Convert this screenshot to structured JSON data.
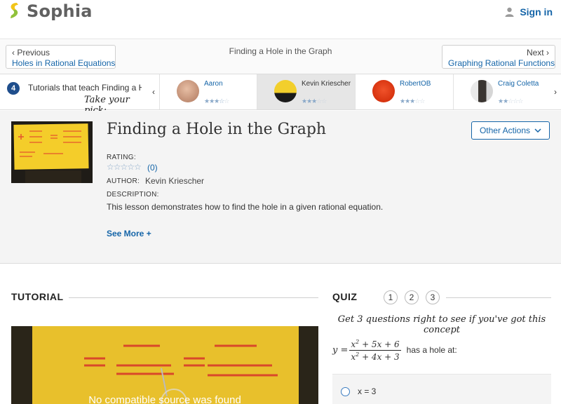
{
  "header": {
    "logo_text": "Sophia",
    "signin_label": "Sign in"
  },
  "nav": {
    "prev_dir": "Previous",
    "prev_title": "Holes in Rational Equations",
    "current_title": "Finding a Hole in the Graph",
    "next_dir": "Next",
    "next_title": "Graphing Rational Functions"
  },
  "tutors": {
    "count": "4",
    "label": "Tutorials that teach Finding a Hole in the Graph",
    "take_pick": "Take your pick:",
    "items": [
      {
        "name": "Aaron",
        "rating": 3.5
      },
      {
        "name": "Kevin Kriescher",
        "rating": 3
      },
      {
        "name": "RobertOB",
        "rating": 3
      },
      {
        "name": "Craig Coletta",
        "rating": 2
      }
    ]
  },
  "lesson": {
    "title": "Finding a Hole in the Graph",
    "other_actions": "Other Actions",
    "rating_label": "RATING:",
    "rating_count": "(0)",
    "author_label": "AUTHOR:",
    "author": "Kevin Kriescher",
    "description_label": "DESCRIPTION:",
    "description": "This lesson demonstrates how to find the hole in a given rational equation.",
    "see_more": "See More +"
  },
  "tutorial": {
    "heading": "TUTORIAL",
    "video_message": "No compatible source was found"
  },
  "quiz": {
    "heading": "QUIZ",
    "numbers": [
      "1",
      "2",
      "3"
    ],
    "instructions": "Get 3 questions right to see if you've got this concept",
    "question_tail": "has a hole at:",
    "option_1": "x = 3"
  },
  "colors": {
    "accent": "#1565a8",
    "badge": "#1f4e8c",
    "logo_yellow": "#9ccb3b"
  }
}
